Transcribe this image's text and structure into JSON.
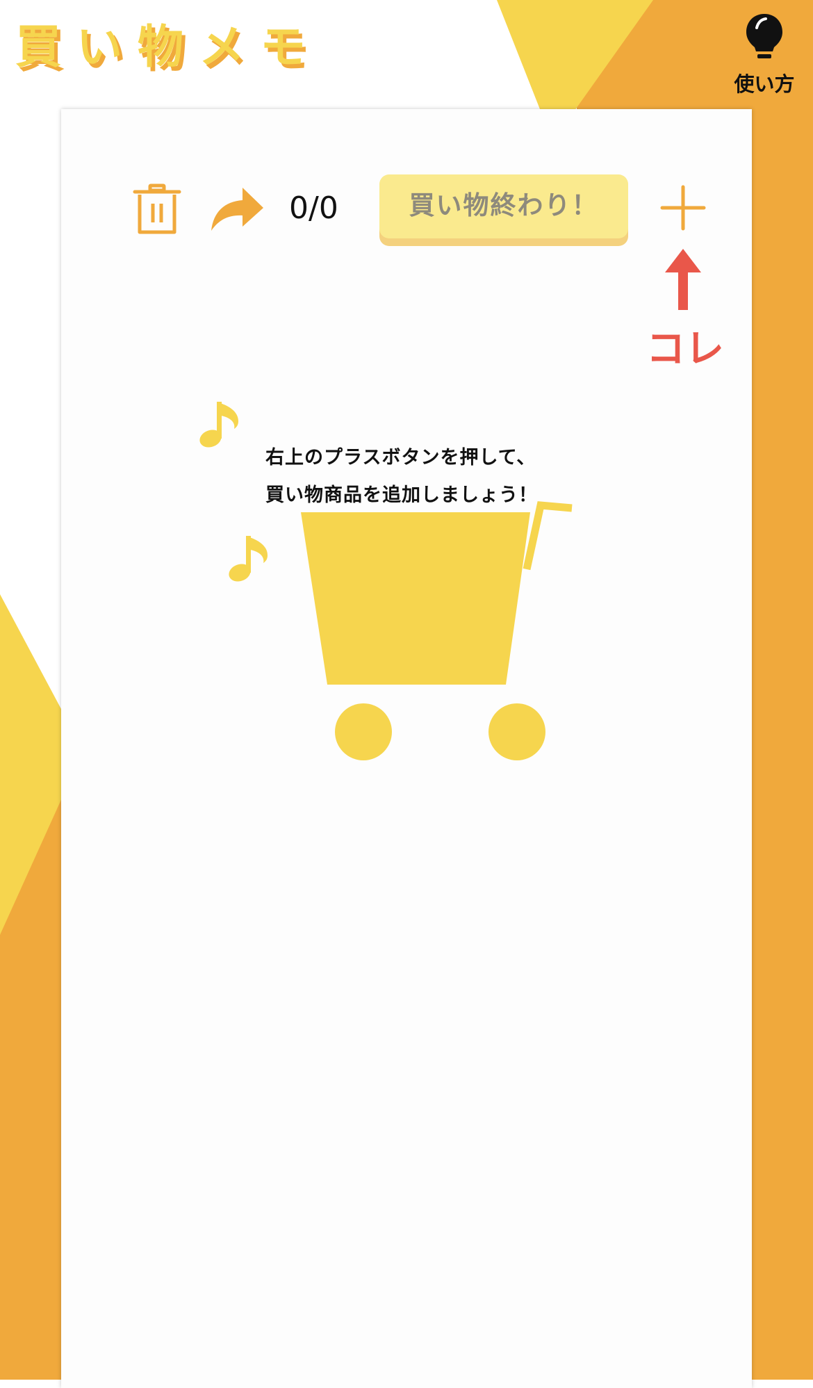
{
  "app": {
    "title": "買い物メモ",
    "help_label": "使い方"
  },
  "toolbar": {
    "trash_icon": "trash-icon",
    "share_icon": "share-arrow-icon",
    "counter": "0/0",
    "finish_label": "買い物終わり！",
    "add_icon": "plus-icon"
  },
  "hint": {
    "label": "コレ"
  },
  "empty_state": {
    "line1": "右上のプラスボタンを押して、",
    "line2": "買い物商品を追加しましょう！"
  },
  "colors": {
    "orange": "#f0a93c",
    "yellow": "#f6d54e",
    "button_yellow": "#faea8e",
    "hint_red": "#e9574a"
  }
}
